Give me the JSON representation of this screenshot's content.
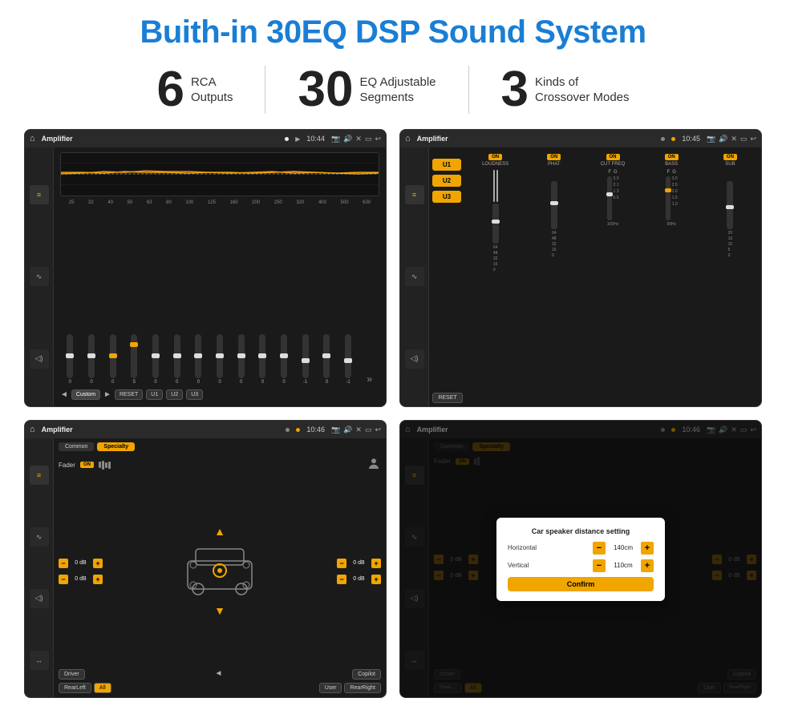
{
  "header": {
    "title": "Buith-in 30EQ DSP Sound System"
  },
  "stats": [
    {
      "number": "6",
      "line1": "RCA",
      "line2": "Outputs"
    },
    {
      "number": "30",
      "line1": "EQ Adjustable",
      "line2": "Segments"
    },
    {
      "number": "3",
      "line1": "Kinds of",
      "line2": "Crossover Modes"
    }
  ],
  "screens": [
    {
      "id": "eq-screen",
      "header": {
        "title": "Amplifier",
        "time": "10:44"
      },
      "type": "eq",
      "freqs": [
        "25",
        "32",
        "40",
        "50",
        "63",
        "80",
        "100",
        "125",
        "160",
        "200",
        "250",
        "320",
        "400",
        "500",
        "630"
      ],
      "values": [
        "0",
        "0",
        "0",
        "5",
        "0",
        "0",
        "0",
        "0",
        "0",
        "0",
        "0",
        "-1",
        "0",
        "-1"
      ],
      "preset": "Custom",
      "buttons": [
        "RESET",
        "U1",
        "U2",
        "U3"
      ]
    },
    {
      "id": "dsp-screen",
      "header": {
        "title": "Amplifier",
        "time": "10:45"
      },
      "type": "dsp",
      "presets": [
        "U1",
        "U2",
        "U3"
      ],
      "channels": [
        {
          "label": "LOUDNESS",
          "on": true
        },
        {
          "label": "PHAT",
          "on": true
        },
        {
          "label": "CUT FREQ",
          "on": true
        },
        {
          "label": "BASS",
          "on": true
        },
        {
          "label": "SUB",
          "on": true
        }
      ],
      "resetBtn": "RESET"
    },
    {
      "id": "xo-screen",
      "header": {
        "title": "Amplifier",
        "time": "10:46"
      },
      "type": "crossover",
      "tabs": [
        "Common",
        "Specialty"
      ],
      "activeTab": "Specialty",
      "fader": "Fader",
      "faderOn": true,
      "dbValues": [
        "0 dB",
        "0 dB",
        "0 dB",
        "0 dB"
      ],
      "bottomBtns": [
        "Driver",
        "RearLeft",
        "All",
        "User",
        "RearRight",
        "Copilot"
      ]
    },
    {
      "id": "xo-dialog-screen",
      "header": {
        "title": "Amplifier",
        "time": "10:46"
      },
      "type": "crossover-dialog",
      "tabs": [
        "Common",
        "Specialty"
      ],
      "dialog": {
        "title": "Car speaker distance setting",
        "horizontal": {
          "label": "Horizontal",
          "value": "140cm"
        },
        "vertical": {
          "label": "Vertical",
          "value": "110cm"
        },
        "confirmBtn": "Confirm"
      },
      "dbValues": [
        "0 dB",
        "0 dB"
      ],
      "bottomBtns": [
        "Driver",
        "RearLeft",
        "All",
        "User",
        "RearRight",
        "Copilot"
      ]
    }
  ]
}
